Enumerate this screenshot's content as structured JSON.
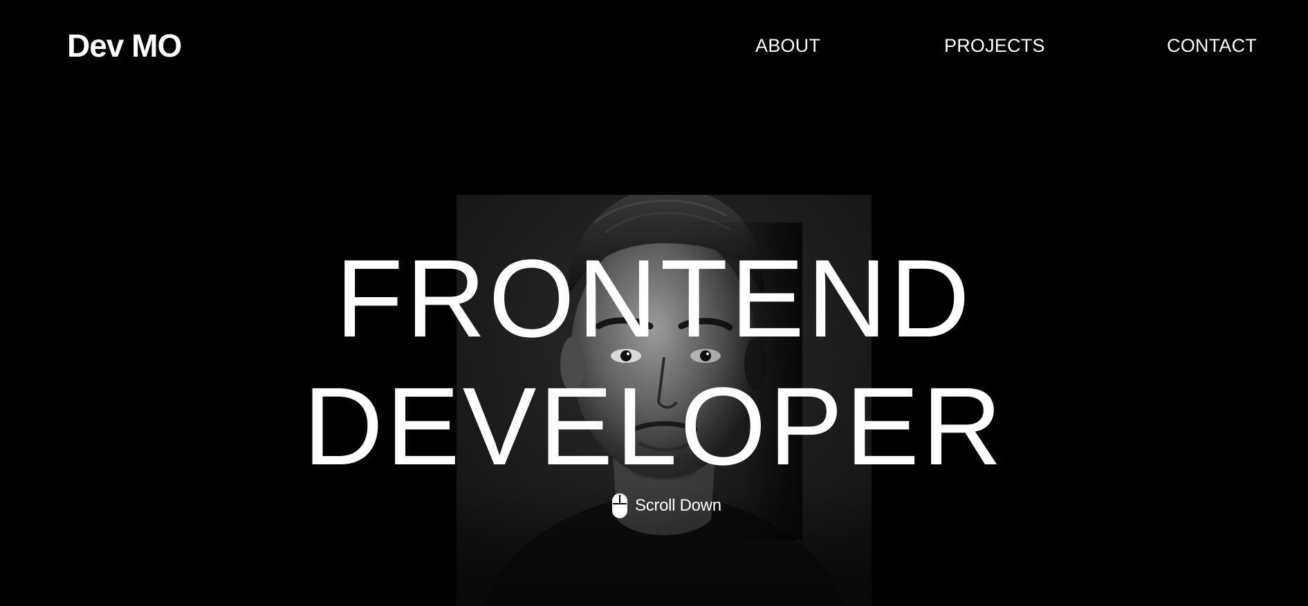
{
  "header": {
    "logo": "Dev MO",
    "nav": {
      "about": "ABOUT",
      "projects": "PROJECTS",
      "contact": "CONTACT"
    }
  },
  "hero": {
    "title_line_1": "FRONTEND",
    "title_line_2": "DEVELOPER",
    "scroll_label": "Scroll Down",
    "scroll_icon": "mouse-icon",
    "portrait_image": "developer-portrait (black and white)"
  },
  "colors": {
    "background": "#000000",
    "text": "#ffffff"
  }
}
